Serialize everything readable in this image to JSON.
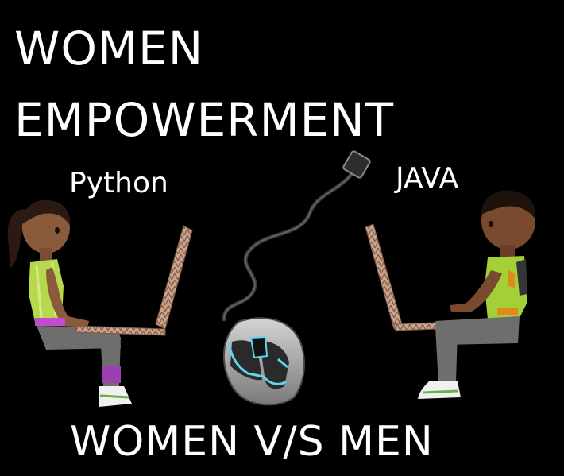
{
  "title": {
    "line1": "WOMEN",
    "line2": "EMPOWERMENT"
  },
  "labels": {
    "left": "Python",
    "right": "JAVA"
  },
  "footer": "WOMEN V/S MEN",
  "colors": {
    "background": "#000000",
    "text": "#ffffff",
    "shirt_female": "#b5d94a",
    "shirt_male": "#a2d036",
    "accent_orange": "#e08a1e",
    "pants": "#6e6e6e",
    "skin": "#8a5a3c",
    "laptop": "#c7a58c",
    "mouse_glow": "#5fd6f0"
  },
  "icons": [
    "female-coder-figure",
    "male-coder-figure",
    "laptop-left",
    "laptop-right",
    "computer-mouse-icon"
  ]
}
